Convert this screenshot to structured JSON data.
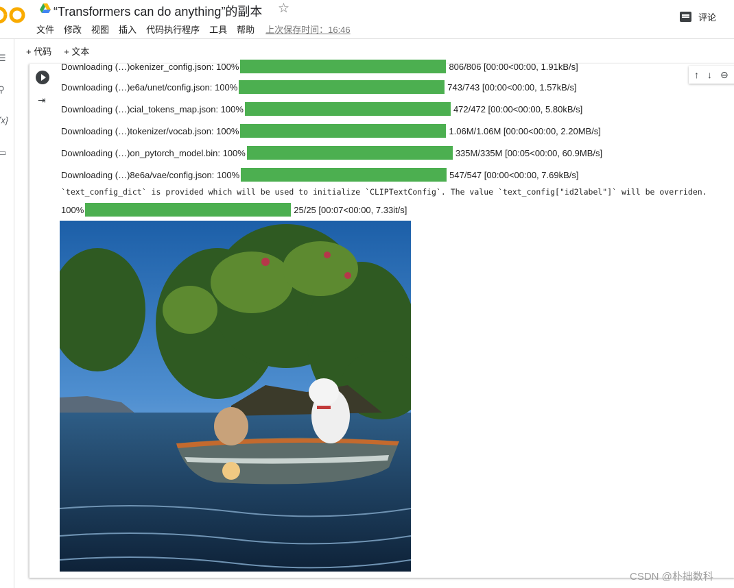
{
  "header": {
    "title": "“Transformers can do anything”的副本",
    "comment_label": "评论",
    "menu": [
      "文件",
      "修改",
      "视图",
      "插入",
      "代码执行程序",
      "工具",
      "帮助"
    ],
    "saved_label": "上次保存时间：16:46"
  },
  "toolbar": {
    "add_code": "+ 代码",
    "add_text": "+ 文本"
  },
  "output": {
    "downloads": [
      {
        "prefix": "Downloading (…)okenizer_config.json: 100%",
        "stats": "806/806 [00:00<00:00, 1.91kB/s]",
        "progress": 1.0
      },
      {
        "prefix": "Downloading (…)e6a/unet/config.json: 100%",
        "stats": "743/743 [00:00<00:00, 1.57kB/s]",
        "progress": 1.0
      },
      {
        "prefix": "Downloading (…)cial_tokens_map.json: 100%",
        "stats": "472/472 [00:00<00:00, 5.80kB/s]",
        "progress": 1.0
      },
      {
        "prefix": "Downloading (…)tokenizer/vocab.json: 100%",
        "stats": "1.06M/1.06M [00:00<00:00, 2.20MB/s]",
        "progress": 1.0
      },
      {
        "prefix": "Downloading (…)on_pytorch_model.bin: 100%",
        "stats": "335M/335M [00:05<00:00, 60.9MB/s]",
        "progress": 1.0
      },
      {
        "prefix": "Downloading (…)8e6a/vae/config.json: 100%",
        "stats": "547/547 [00:00<00:00, 7.69kB/s]",
        "progress": 1.0
      }
    ],
    "warning": "`text_config_dict` is provided which will be used to initialize `CLIPTextConfig`. The value `text_config[\"id2label\"]` will be overriden.",
    "final_prefix": "100%",
    "final_stats": "25/25 [00:07<00:00, 7.33it/s]",
    "final_progress": 1.0
  },
  "watermark": "CSDN @朴拙数科",
  "colors": {
    "progress": "#4caf50",
    "logo_orange": "#f9ab00"
  }
}
